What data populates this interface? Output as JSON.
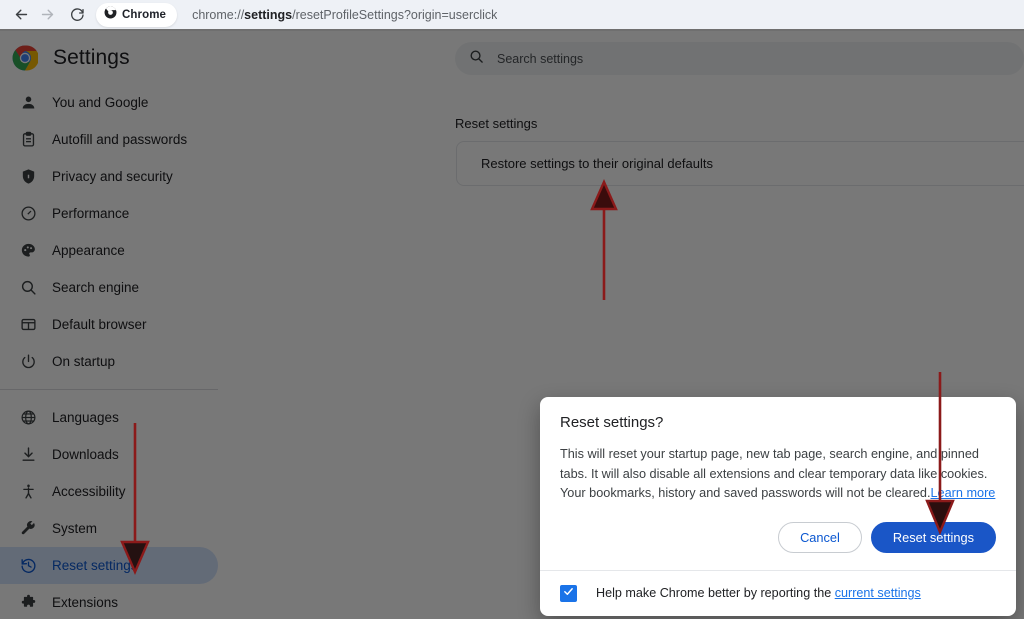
{
  "browser": {
    "back_icon": "back-arrow-icon",
    "forward_icon": "forward-arrow-icon",
    "reload_icon": "reload-icon",
    "tab_chip_label": "Chrome",
    "tab_chip_icon": "chrome-icon",
    "url_prefix": "chrome://",
    "url_host": "settings",
    "url_path": "/resetProfileSettings?origin=userclick",
    "url_full": "chrome://settings/resetProfileSettings?origin=userclick"
  },
  "settings": {
    "logo_icon": "chrome-logo-icon",
    "title": "Settings",
    "search": {
      "icon": "search-icon",
      "placeholder": "Search settings",
      "value": ""
    }
  },
  "sidebar": {
    "items": [
      {
        "label": "You and Google",
        "icon": "person-icon",
        "selected": false
      },
      {
        "label": "Autofill and passwords",
        "icon": "clipboard-icon",
        "selected": false
      },
      {
        "label": "Privacy and security",
        "icon": "shield-icon",
        "selected": false
      },
      {
        "label": "Performance",
        "icon": "speedometer-icon",
        "selected": false
      },
      {
        "label": "Appearance",
        "icon": "palette-icon",
        "selected": false
      },
      {
        "label": "Search engine",
        "icon": "search-icon",
        "selected": false
      },
      {
        "label": "Default browser",
        "icon": "browser-window-icon",
        "selected": false
      },
      {
        "label": "On startup",
        "icon": "power-icon",
        "selected": false
      }
    ],
    "items_secondary": [
      {
        "label": "Languages",
        "icon": "globe-icon",
        "selected": false
      },
      {
        "label": "Downloads",
        "icon": "download-icon",
        "selected": false
      },
      {
        "label": "Accessibility",
        "icon": "accessibility-icon",
        "selected": false
      },
      {
        "label": "System",
        "icon": "wrench-icon",
        "selected": false
      },
      {
        "label": "Reset settings",
        "icon": "history-restore-icon",
        "selected": true
      }
    ],
    "items_partial": [
      {
        "label": "Extensions",
        "icon": "extension-icon",
        "selected": false
      }
    ]
  },
  "main": {
    "section_title": "Reset settings",
    "card_label": "Restore settings to their original defaults",
    "card_chevron_icon": "chevron-right-icon"
  },
  "dialog": {
    "title": "Reset settings?",
    "body_line1": "This will reset your startup page, new tab page, search engine, and pinned",
    "body_line2": "tabs. It will also disable all extensions and clear temporary data like cookies.",
    "body_line3": "Your bookmarks, history and saved passwords will not be cleared.",
    "learn_more_label": "Learn more",
    "cancel_label": "Cancel",
    "confirm_label": "Reset settings",
    "checkbox_checked": true,
    "checkbox_icon": "checkmark-icon",
    "footer_label": "Help make Chrome better by reporting the ",
    "footer_link_label": "current settings"
  },
  "annotations": {
    "color": "#8b1a1a",
    "arrows": [
      {
        "name": "arrow-to-restore-card",
        "direction": "up"
      },
      {
        "name": "arrow-to-reset-settings-nav",
        "direction": "down"
      },
      {
        "name": "arrow-to-reset-settings-button",
        "direction": "down"
      }
    ]
  },
  "colors": {
    "accent_blue": "#1a73e8",
    "button_blue": "#1a56c7",
    "nav_selected_bg": "#d3e3fd",
    "nav_selected_text": "#0b57d0",
    "scrim": "rgba(0,0,0,0.53)",
    "annotation_red": "#8b1a1a"
  }
}
